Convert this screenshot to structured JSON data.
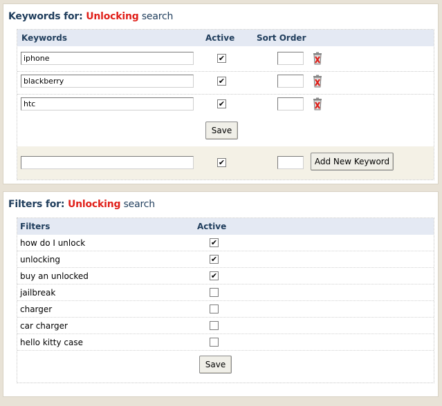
{
  "keywords_panel": {
    "title_prefix": "Keywords for: ",
    "title_highlight": "Unlocking",
    "title_suffix": " search",
    "headers": {
      "keywords": "Keywords",
      "active": "Active",
      "sort_order": "Sort Order"
    },
    "rows": [
      {
        "keyword": "iphone",
        "active": true,
        "sort_order": ""
      },
      {
        "keyword": "blackberry",
        "active": true,
        "sort_order": ""
      },
      {
        "keyword": "htc",
        "active": true,
        "sort_order": ""
      }
    ],
    "save_label": "Save",
    "new_keyword": {
      "value": "",
      "active": true,
      "sort_order": ""
    },
    "add_label": "Add New Keyword"
  },
  "filters_panel": {
    "title_prefix": "Filters for: ",
    "title_highlight": "Unlocking",
    "title_suffix": " search",
    "headers": {
      "filters": "Filters",
      "active": "Active"
    },
    "rows": [
      {
        "label": "how do I unlock",
        "active": true
      },
      {
        "label": "unlocking",
        "active": true
      },
      {
        "label": "buy an unlocked",
        "active": true
      },
      {
        "label": "jailbreak",
        "active": false
      },
      {
        "label": "charger",
        "active": false
      },
      {
        "label": "car charger",
        "active": false
      },
      {
        "label": "hello kitty case",
        "active": false
      }
    ],
    "save_label": "Save"
  },
  "colors": {
    "highlight": "#e0201a",
    "title": "#1f3d5c",
    "header_bg": "#e4e9f3",
    "add_row_bg": "#f4f1e6"
  }
}
